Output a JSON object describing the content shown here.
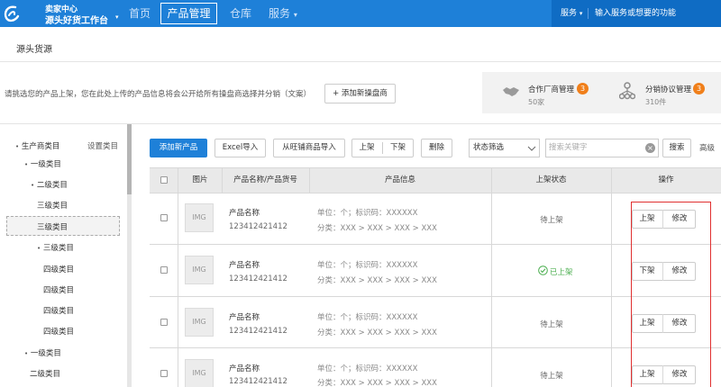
{
  "topbar": {
    "brand_line1": "卖家中心",
    "brand_line2": "源头好货工作台",
    "nav": [
      {
        "label": "首页"
      },
      {
        "label": "产品管理"
      },
      {
        "label": "仓库"
      },
      {
        "label": "服务"
      }
    ],
    "service_label": "服务",
    "search_placeholder": "输入服务或想要的功能"
  },
  "page": {
    "title": "源头货源",
    "description": "请挑选您的产品上架，您在此处上传的产品信息将会公开给所有操盘商选择并分销（文案）",
    "add_dealer": "+ 添加新操盘商"
  },
  "info": {
    "manager1": {
      "label": "合作厂商管理",
      "badge": "3",
      "count": "50家"
    },
    "manager2": {
      "label": "分销协议管理",
      "badge": "3",
      "count": "310件"
    }
  },
  "sidebar": {
    "settings": "设置类目",
    "items": [
      {
        "label": "生产商类目"
      },
      {
        "label": "一级类目"
      },
      {
        "label": "二级类目"
      },
      {
        "label": "三级类目"
      },
      {
        "label": "三级类目"
      },
      {
        "label": "三级类目"
      },
      {
        "label": "四级类目"
      },
      {
        "label": "四级类目"
      },
      {
        "label": "四级类目"
      },
      {
        "label": "四级类目"
      },
      {
        "label": "一级类目"
      },
      {
        "label": "二级类目"
      }
    ]
  },
  "toolbar": {
    "add_product": "添加新产品",
    "excel_import": "Excel导入",
    "wangpu_import": "从旺铺商品导入",
    "on_shelf": "上架",
    "off_shelf": "下架",
    "delete": "删除",
    "status_filter": "状态筛选",
    "search_placeholder": "搜索关键字",
    "search": "搜索",
    "advanced": "高级"
  },
  "table": {
    "headers": [
      "图片",
      "产品名称/产品货号",
      "产品信息",
      "上架状态",
      "操作"
    ],
    "rows": [
      {
        "img": "IMG",
        "name": "产品名称",
        "code": "123412421412",
        "info1": "单位：个；标识码：XXXXXX",
        "info2": "分类：XXX > XXX > XXX > XXX",
        "status": "待上架",
        "op1": "上架",
        "op2": "修改"
      },
      {
        "img": "IMG",
        "name": "产品名称",
        "code": "123412421412",
        "info1": "单位：个；标识码：XXXXXX",
        "info2": "分类：XXX > XXX > XXX > XXX",
        "status": "已上架",
        "op1": "下架",
        "op2": "修改"
      },
      {
        "img": "IMG",
        "name": "产品名称",
        "code": "123412421412",
        "info1": "单位：个；标识码：XXXXXX",
        "info2": "分类：XXX > XXX > XXX > XXX",
        "status": "待上架",
        "op1": "上架",
        "op2": "修改"
      },
      {
        "img": "IMG",
        "name": "产品名称",
        "code": "123412421412",
        "info1": "单位：个；标识码：XXXXXX",
        "info2": "分类：XXX > XXX > XXX > XXX",
        "status": "待上架",
        "op1": "上架",
        "op2": "修改"
      }
    ]
  },
  "colors": {
    "primary": "#1e80d8",
    "badge": "#f07f1a",
    "highlight": "#e03030",
    "success": "#4caf50"
  }
}
